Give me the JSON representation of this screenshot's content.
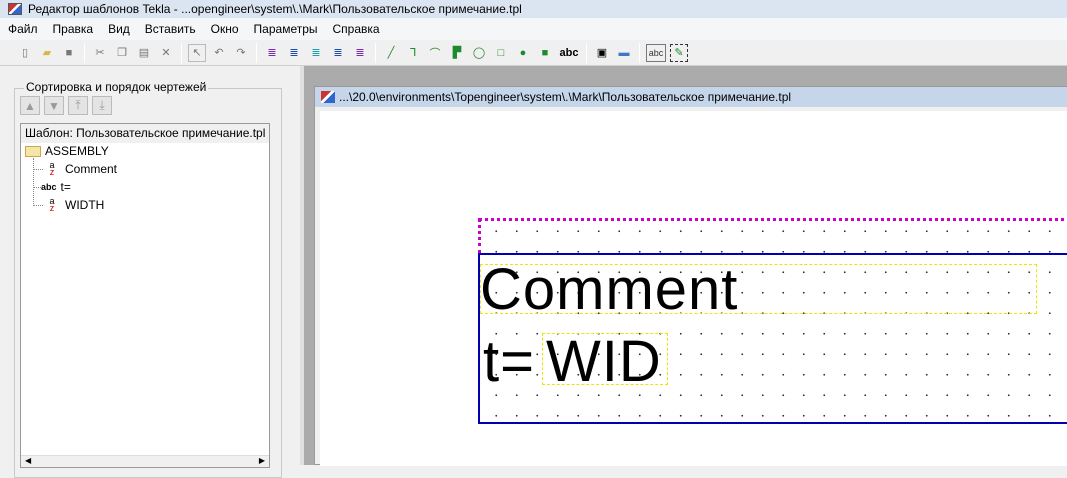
{
  "window": {
    "title": "Редактор шаблонов Tekla - ...opengineer\\system\\.\\Mark\\Пользовательское примечание.tpl"
  },
  "menu": [
    "Файл",
    "Правка",
    "Вид",
    "Вставить",
    "Окно",
    "Параметры",
    "Справка"
  ],
  "toolbar": {
    "abc_label": "abc",
    "abc2_label": "abc"
  },
  "left_panel": {
    "group_title": "Сортировка и порядок чертежей",
    "tree_header": "Шаблон: Пользовательское примечание.tpl",
    "nodes": {
      "assembly": "ASSEMBLY",
      "comment": "Comment",
      "text": "t=",
      "width": "WIDTH",
      "abc": "abc"
    }
  },
  "document": {
    "title": "...\\20.0\\environments\\Topengineer\\system\\.\\Mark\\Пользовательское примечание.tpl",
    "field_comment": "Comment",
    "text_prefix": "t=",
    "field_width": "WID"
  }
}
